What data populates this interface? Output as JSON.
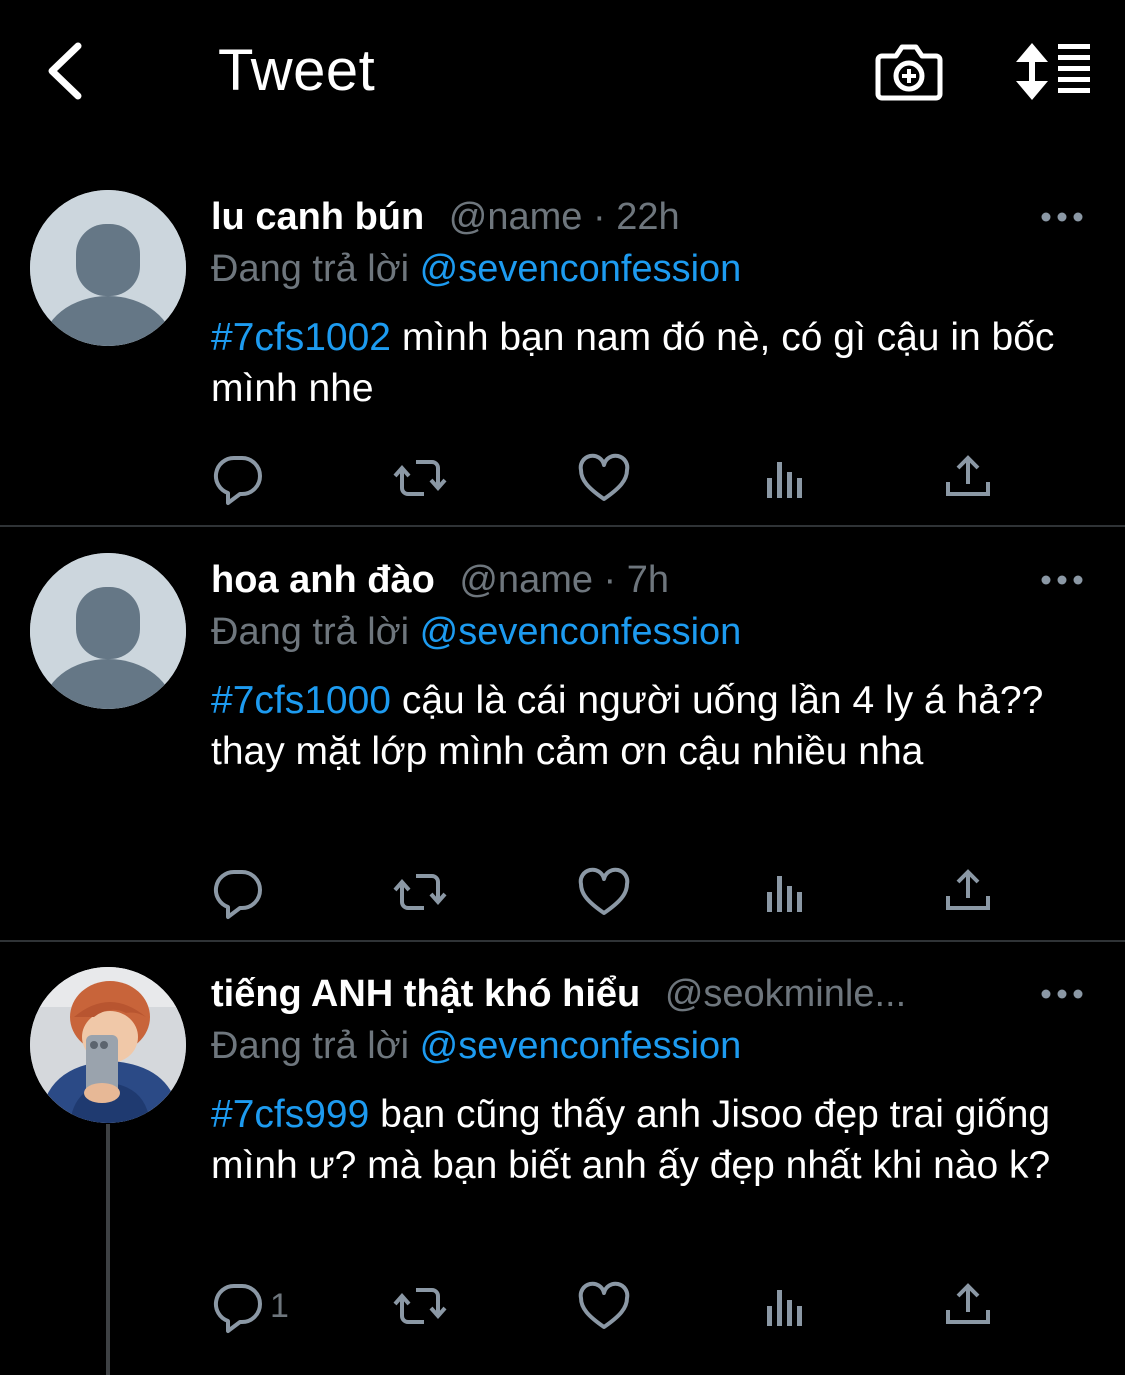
{
  "header": {
    "title": "Tweet",
    "back_icon": "chevron-left-icon",
    "camera_icon": "camera-plus-icon",
    "sort_icon": "sort-list-icon"
  },
  "colors": {
    "background": "#000000",
    "link": "#1d9bf0",
    "muted": "#6e767d",
    "divider": "#2f3336"
  },
  "tweets": [
    {
      "name": "lu canh bún",
      "handle": "@name",
      "dot": " · ",
      "time": "22h",
      "reply_prefix": "Đang trả lời ",
      "reply_to": "@sevenconfession",
      "hashtag": "#7cfs1002",
      "text": " mình bạn nam đó nè, có gì cậu in bốc mình nhe",
      "reply_count": "",
      "avatar": "default-avatar"
    },
    {
      "name": "hoa anh đào",
      "handle": "@name",
      "dot": " · ",
      "time": "7h",
      "reply_prefix": "Đang trả lời ",
      "reply_to": "@sevenconfession",
      "hashtag": "#7cfs1000",
      "text": " cậu là cái người uống lần 4 ly á hả?? thay mặt lớp mình cảm ơn cậu nhiều nha",
      "reply_count": "",
      "avatar": "default-avatar"
    },
    {
      "name": "tiếng ANH thật khó hiểu",
      "handle": "@seokminle...",
      "dot": "",
      "time": "",
      "reply_prefix": "Đang trả lời ",
      "reply_to": "@sevenconfession",
      "hashtag": "#7cfs999",
      "text": " bạn cũng thấy anh Jisoo đẹp trai giống mình ư? mà bạn biết anh ấy đẹp nhất khi nào k?",
      "reply_count": "1",
      "avatar": "photo-avatar"
    }
  ]
}
